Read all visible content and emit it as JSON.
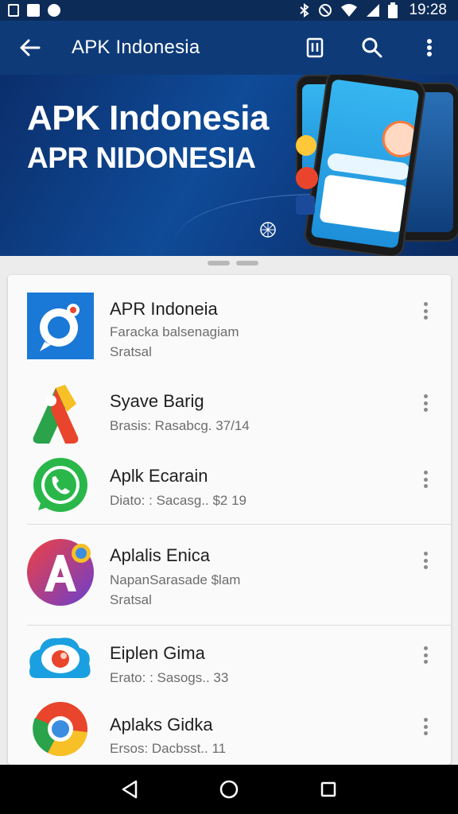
{
  "status_bar": {
    "time": "19:28",
    "icons": [
      "sim-icon",
      "image-icon",
      "record-icon",
      "bluetooth-icon",
      "nfc-icon",
      "wifi-icon",
      "signal-icon",
      "battery-icon"
    ]
  },
  "app_bar": {
    "title": "APK Indonesia",
    "actions": [
      "bookmark-icon",
      "search-icon",
      "more-vert-icon"
    ]
  },
  "banner": {
    "line1": "APK Indonesia",
    "line2": "APR NIDONESIA"
  },
  "apps": [
    {
      "name": "APR Indoneia",
      "sub1": "Faracka balsenagiam",
      "sub2": "Sratsal",
      "icon": "camera-chat-icon"
    },
    {
      "name": "Syave Barig",
      "sub1": "Brasis: Rasabcg.  37/14",
      "sub2": "",
      "icon": "triangle-logo-icon"
    },
    {
      "name": "Aplk Ecarain",
      "sub1": "Diato: : Sacasg..  $2 19",
      "sub2": "",
      "icon": "whatsapp-icon"
    },
    {
      "name": "Aplalis Enica",
      "sub1": "NapanSarasade $lam",
      "sub2": "Sratsal",
      "icon": "letter-a-icon"
    },
    {
      "name": "Eiplen Gima",
      "sub1": "Erato: : Sasogs..  33",
      "sub2": "",
      "icon": "cloud-eye-icon"
    },
    {
      "name": "Aplaks Gidka",
      "sub1": "Ersos: Dacbsst..  11",
      "sub2": "",
      "icon": "chrome-like-icon"
    }
  ],
  "colors": {
    "status_bar": "#0d2b57",
    "app_bar": "#0e3a78",
    "accent": "#1e7fe0"
  },
  "nav_bar": [
    "back-triangle-icon",
    "home-circle-icon",
    "recents-square-icon"
  ]
}
